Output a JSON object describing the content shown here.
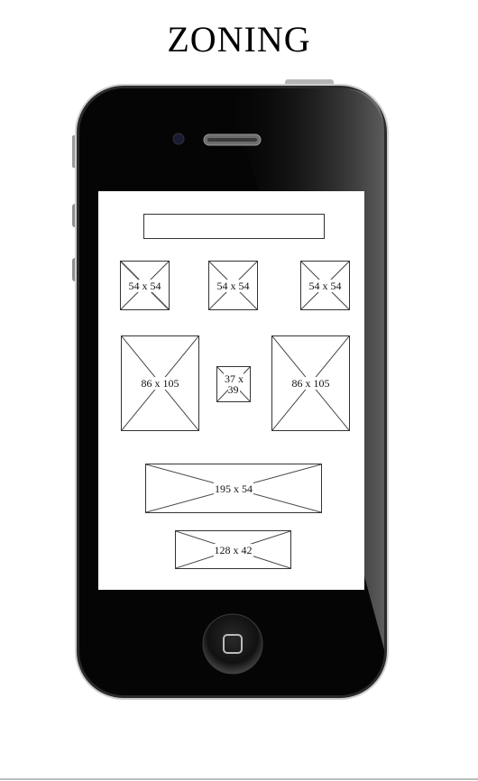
{
  "title": "ZONING",
  "placeholders": {
    "box1": "54 x 54",
    "box2": "54 x 54",
    "box3": "54 x 54",
    "box4": "86 x 105",
    "box5": "37 x 39",
    "box6": "86 x 105",
    "box7": "195 x 54",
    "box8": "128 x 42"
  }
}
